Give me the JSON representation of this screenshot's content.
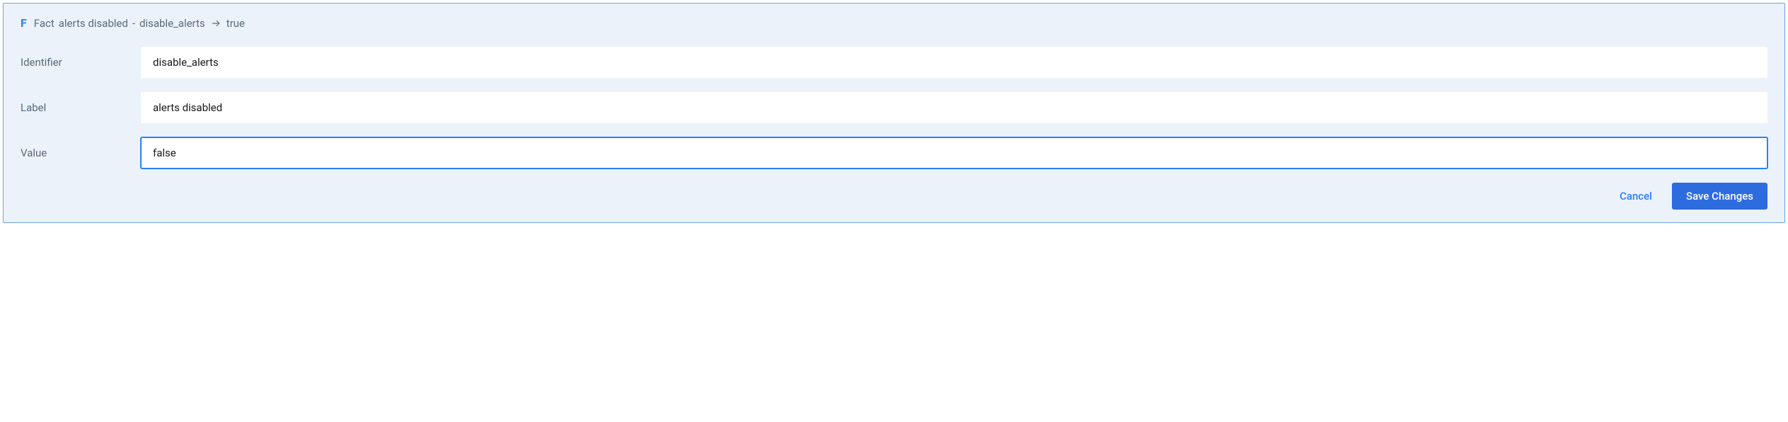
{
  "header": {
    "icon_letter": "F",
    "prefix": "Fact",
    "label": "alerts disabled",
    "separator": "-",
    "identifier": "disable_alerts",
    "current_value": "true"
  },
  "form": {
    "identifier": {
      "label": "Identifier",
      "value": "disable_alerts"
    },
    "label_field": {
      "label": "Label",
      "value": "alerts disabled"
    },
    "value_field": {
      "label": "Value",
      "value": "false"
    }
  },
  "actions": {
    "cancel": "Cancel",
    "save": "Save Changes"
  }
}
